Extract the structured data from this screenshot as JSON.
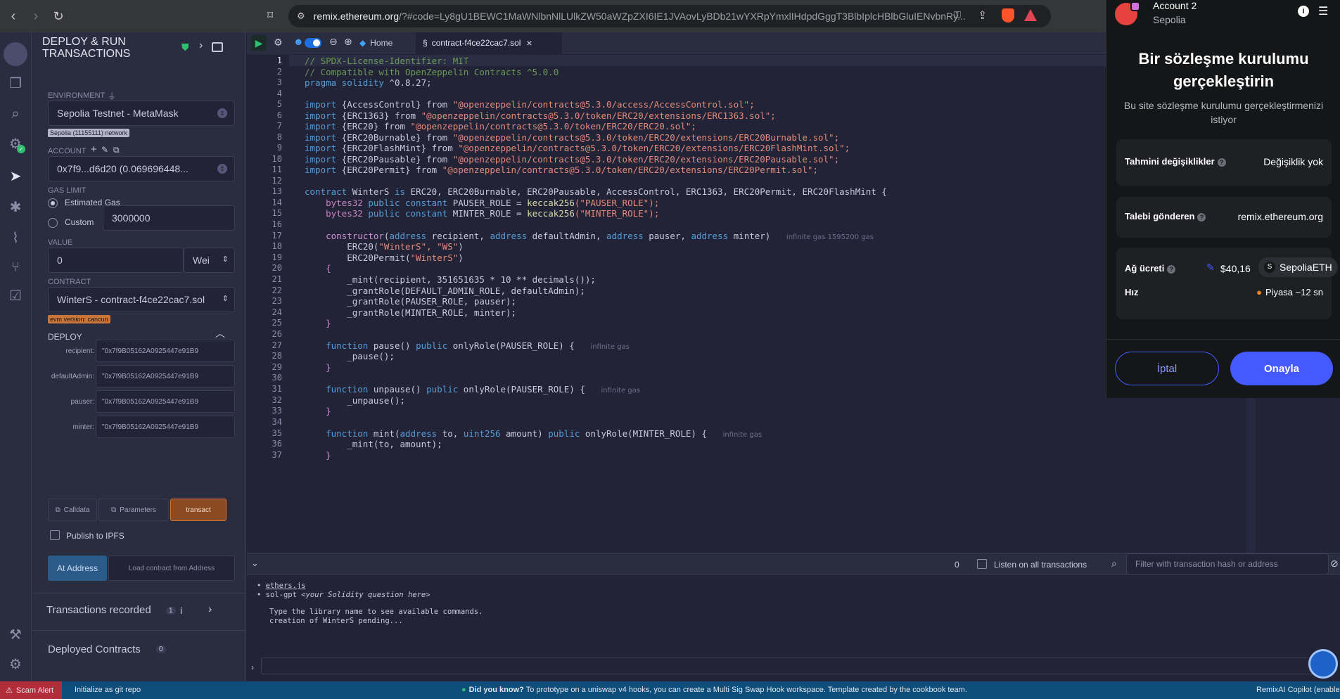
{
  "browser": {
    "url_lead": "remix.ethereum.org",
    "url_rest": "/?#code=Ly8gU1BEWC1MaWNlbnNlLUlkZW50aWZpZXI6IE1JVAovLyBDb21wYXRpYmxlIHdpdGggT3BlbIplcHBlbGluIENvbnRy..."
  },
  "sidebar": {
    "title_line1": "DEPLOY & RUN",
    "title_line2": "TRANSACTIONS",
    "environment_label": "ENVIRONMENT",
    "environment_value": "Sepolia Testnet - MetaMask",
    "network_badge": "Sepolia (11155111) network",
    "account_label": "ACCOUNT",
    "account_value": "0x7f9...d6d20 (0.069696448...",
    "gas_limit_label": "GAS LIMIT",
    "estimated_gas": "Estimated Gas",
    "custom": "Custom",
    "custom_value": "3000000",
    "value_label": "VALUE",
    "value_amount": "0",
    "value_unit": "Wei",
    "contract_label": "CONTRACT",
    "contract_value": "WinterS - contract-f4ce22cac7.sol",
    "evm_badge": "evm version: cancun",
    "deploy_label": "DEPLOY",
    "params": [
      {
        "name": "recipient:",
        "value": "\"0x7f9B05162A0925447e91B9"
      },
      {
        "name": "defaultAdmin:",
        "value": "\"0x7f9B05162A0925447e91B9"
      },
      {
        "name": "pauser:",
        "value": "\"0x7f9B05162A0925447e91B9"
      },
      {
        "name": "minter:",
        "value": "\"0x7f9B05162A0925447e91B9"
      }
    ],
    "calldata_btn": "Calldata",
    "parameters_btn": "Parameters",
    "transact_btn": "transact",
    "publish_ipfs": "Publish to IPFS",
    "at_address_btn": "At Address",
    "load_contract_btn": "Load contract from Address",
    "transactions_recorded": "Transactions recorded",
    "transactions_count": "1",
    "deployed_contracts": "Deployed Contracts",
    "deployed_count": "0"
  },
  "editor": {
    "home_tab": "Home",
    "file_tab": "contract-f4ce22cac7.sol",
    "lines": [
      "1",
      "2",
      "3",
      "4",
      "5",
      "6",
      "7",
      "8",
      "9",
      "10",
      "11",
      "12",
      "13",
      "14",
      "15",
      "16",
      "17",
      "18",
      "19",
      "20",
      "21",
      "22",
      "23",
      "24",
      "25",
      "26",
      "27",
      "28",
      "29",
      "30",
      "31",
      "32",
      "33",
      "34",
      "35",
      "36",
      "37"
    ],
    "code": {
      "l1": "// SPDX-License-Identifier: MIT",
      "l2": "// Compatible with OpenZeppelin Contracts ^5.0.0",
      "l3_kw": "pragma solidity",
      "l3_rest": " ^0.8.27;",
      "imp_kw": "import",
      "from_kw": "from",
      "i5_name": " {AccessControl} ",
      "i5_path": " \"@openzeppelin/contracts@5.3.0/access/AccessControl.sol\";",
      "i6_name": " {ERC1363} ",
      "i6_path": " \"@openzeppelin/contracts@5.3.0/token/ERC20/extensions/ERC1363.sol\";",
      "i7_name": " {ERC20} ",
      "i7_path": " \"@openzeppelin/contracts@5.3.0/token/ERC20/ERC20.sol\";",
      "i8_name": " {ERC20Burnable} ",
      "i8_path": " \"@openzeppelin/contracts@5.3.0/token/ERC20/extensions/ERC20Burnable.sol\";",
      "i9_name": " {ERC20FlashMint} ",
      "i9_path": " \"@openzeppelin/contracts@5.3.0/token/ERC20/extensions/ERC20FlashMint.sol\";",
      "i10_name": " {ERC20Pausable} ",
      "i10_path": " \"@openzeppelin/contracts@5.3.0/token/ERC20/extensions/ERC20Pausable.sol\";",
      "i11_name": " {ERC20Permit} ",
      "i11_path": " \"@openzeppelin/contracts@5.3.0/token/ERC20/extensions/ERC20Permit.sol\";",
      "l13_kw": "contract",
      "l13_name": " WinterS ",
      "l13_is": "is",
      "l13_rest": " ERC20, ERC20Burnable, ERC20Pausable, AccessControl, ERC1363, ERC20Permit, ERC20FlashMint {",
      "l14_ty": "bytes32",
      "l14_kw": " public constant",
      "l14_mid": " PAUSER_ROLE = ",
      "l14_fn": "keccak256",
      "l14_st": "(\"PAUSER_ROLE\");",
      "l15_mid": " MINTER_ROLE = ",
      "l15_st": "(\"MINTER_ROLE\");",
      "l17_kw": "constructor",
      "l17_a": "address",
      "l17_rest1": " recipient, ",
      "l17_rest2": " defaultAdmin, ",
      "l17_rest3": " pauser, ",
      "l17_rest4": " minter)",
      "l17_gas": "infinite gas 1595200 gas",
      "l18": "ERC20(",
      "l18_st": "\"WinterS\", \"WS\"",
      "l18_end": ")",
      "l19": "ERC20Permit(",
      "l19_st": "\"WinterS\"",
      "l19_end": ")",
      "l20": "{",
      "l21": "_mint(recipient, 351651635 * 10 ** decimals());",
      "l22": "_grantRole(DEFAULT_ADMIN_ROLE, defaultAdmin);",
      "l23": "_grantRole(PAUSER_ROLE, pauser);",
      "l24": "_grantRole(MINTER_ROLE, minter);",
      "l25": "}",
      "fn_kw": "function",
      "l27_rest": " pause() ",
      "pub_kw": "public",
      "l27_mod": " onlyRole(PAUSER_ROLE) {",
      "gas_inf": "infinite gas",
      "l28": "_pause();",
      "l29": "}",
      "l31_rest": " unpause() ",
      "l32": "_unpause();",
      "l33": "}",
      "l35_rest": " mint(",
      "l35_a": "address",
      "l35_to": " to, ",
      "l35_u": "uint256",
      "l35_amt": " amount) ",
      "l35_mod": " onlyRole(MINTER_ROLE) {",
      "l36": "_mint(to, amount);",
      "l37": "}"
    }
  },
  "terminal": {
    "count": "0",
    "listen_label": "Listen on all transactions",
    "filter_placeholder": "Filter with transaction hash or address",
    "bullet1": "ethers.js",
    "bullet2_a": "sol-gpt ",
    "bullet2_b": "<your Solidity question here>",
    "line3": "Type the library name to see available commands.",
    "line4": "creation of WinterS pending..."
  },
  "statusbar": {
    "scam_alert": "Scam Alert",
    "git": "Initialize as git repo",
    "did_you_know": "Did you know?",
    "tip": "To prototype on a uniswap v4 hooks, you can create a Multi Sig Swap Hook workspace. Template created by the cookbook team.",
    "copilot": "RemixAI Copilot (enabled)"
  },
  "metamask": {
    "account_name": "Account 2",
    "network": "Sepolia",
    "title": "Bir sözleşme kurulumu gerçekleştirin",
    "subtitle": "Bu site sözleşme kurulumu gerçekleştirmenizi istiyor",
    "estimated_changes_label": "Tahmini değişiklikler",
    "estimated_changes_value": "Değişiklik yok",
    "requester_label": "Talebi gönderen",
    "requester_value": "remix.ethereum.org",
    "network_fee_label": "Ağ ücreti",
    "network_fee_value": "$40,16",
    "fee_token": "SepoliaETH",
    "speed_label": "Hız",
    "speed_value": "Piyasa ~12 sn",
    "cancel_btn": "İptal",
    "confirm_btn": "Onayla"
  },
  "colors": {
    "accent_blue": "#1c6fdc",
    "transact_orange": "#c97539",
    "metamask_confirm": "#4459ff"
  }
}
